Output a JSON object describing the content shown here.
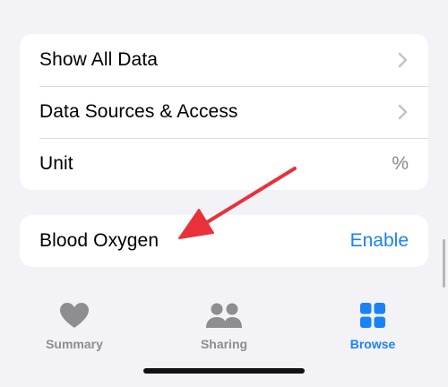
{
  "settings": {
    "rows": [
      {
        "label": "Show All Data",
        "accessory": "chevron-right-icon"
      },
      {
        "label": "Data Sources & Access",
        "accessory": "chevron-right-icon"
      },
      {
        "label": "Unit",
        "value": "%"
      }
    ]
  },
  "blood_oxygen": {
    "label": "Blood Oxygen",
    "action": "Enable"
  },
  "tab_bar": {
    "tabs": [
      {
        "label": "Summary",
        "icon": "heart-icon",
        "active": false
      },
      {
        "label": "Sharing",
        "icon": "people-icon",
        "active": false
      },
      {
        "label": "Browse",
        "icon": "grid-icon",
        "active": true
      }
    ]
  },
  "colors": {
    "accent": "#1a82f7",
    "annotation_arrow": "#e8313a",
    "background": "#f2f2f7",
    "inactive_tab": "#8d8d92"
  }
}
